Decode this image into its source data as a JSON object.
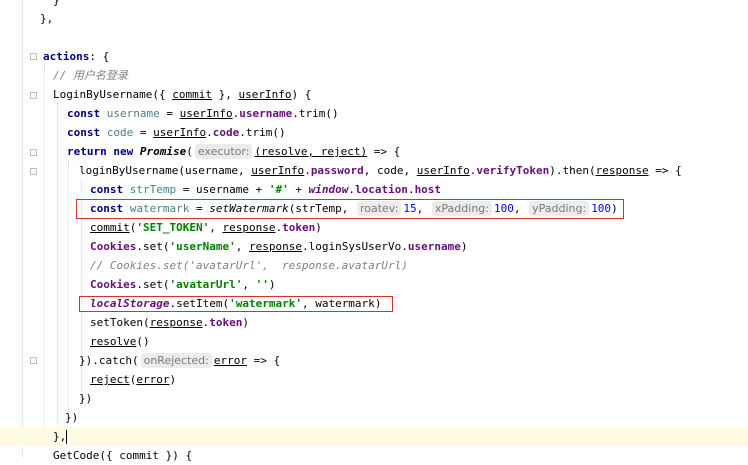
{
  "code": {
    "l0": {
      "text": "}"
    },
    "l1": {
      "text": "},"
    },
    "l3": {
      "kw": "actions",
      "rest": ": {"
    },
    "l4": {
      "comment": "// 用户名登录"
    },
    "l5": {
      "name": "LoginByUsername",
      "p1": "({ ",
      "commit": "commit",
      "p2": " }, ",
      "userInfo": "userInfo",
      "p3": ") {"
    },
    "l6": {
      "kw": "const",
      "var": " username",
      "eq": " = ",
      "obj": "userInfo",
      "dot": ".",
      "prop": "username",
      "dot2": ".",
      "call": "trim()"
    },
    "l7": {
      "kw": "const",
      "var": " code",
      "eq": " = ",
      "obj": "userInfo",
      "dot": ".",
      "prop": "code",
      "dot2": ".",
      "call": "trim()"
    },
    "l8": {
      "kw1": "return",
      "kw2": "new",
      "cls": "Promise",
      "open": "(",
      "hint": "executor:",
      "args": "(resolve, reject)",
      "arrow": " => {"
    },
    "l9": {
      "fn": "loginByUsername",
      "a1": "(username, ",
      "obj": "userInfo",
      "dot": ".",
      "prop1": "password",
      "a2": ", code, ",
      "obj2": "userInfo",
      "dot2": ".",
      "prop2": "verifyToken",
      "a3": ").then(",
      "resp": "response",
      "a4": " => {"
    },
    "l10": {
      "kw": "const",
      "var": " strTemp",
      "eq": " = username + ",
      "str": "'#'",
      "plus": " + ",
      "glob": "window",
      "dot": ".",
      "prop": "location",
      "dot2": ".",
      "prop2": "host"
    },
    "l11": {
      "kw": "const",
      "var": " watermark",
      "eq": " = ",
      "fn": "setWatermark",
      "a1": "(strTemp,",
      "h1": "roatev:",
      "n1": "15",
      "c1": ",",
      "h2": "xPadding:",
      "n2": "100",
      "c2": ",",
      "h3": "yPadding:",
      "n3": "100",
      "close": ")"
    },
    "l12": {
      "fn": "commit",
      "open": "(",
      "str": "'SET_TOKEN'",
      "mid": ", ",
      "obj": "response",
      "dot": ".",
      "prop": "token",
      "close": ")"
    },
    "l13": {
      "obj": "Cookies",
      "dot": ".",
      "meth": "set",
      "open": "(",
      "str": "'userName'",
      "mid": ", ",
      "obj2": "response",
      "dot2": ".",
      "meth2": "loginSysUserVo",
      "dot3": ".",
      "prop": "username",
      "close": ")"
    },
    "l14": {
      "comment": "// Cookies.set('avatarUrl',  response.avatarUrl)"
    },
    "l15": {
      "obj": "Cookies",
      "dot": ".",
      "meth": "set",
      "open": "(",
      "str": "'avatarUrl'",
      "mid": ", ",
      "str2": "''",
      "close": ")"
    },
    "l16": {
      "glob": "localStorage",
      "dot": ".",
      "meth": "setItem",
      "open": "(",
      "str": "'watermark'",
      "mid": ", watermark",
      "close": ")"
    },
    "l17": {
      "fn": "setToken",
      "open": "(",
      "obj": "response",
      "dot": ".",
      "prop": "token",
      "close": ")"
    },
    "l18": {
      "fn": "resolve",
      "call": "()"
    },
    "l19": {
      "close": "}).catch(",
      "hint": "onRejected:",
      "arg": "error",
      "arrow": " => {"
    },
    "l20": {
      "fn": "reject",
      "open": "(",
      "arg": "error",
      "close": ")"
    },
    "l21": {
      "text": "})"
    },
    "l22": {
      "text": "})"
    },
    "l23": {
      "text": "},"
    },
    "l24": {
      "name": "GetCode",
      "rest": "({ commit }) {"
    }
  },
  "colors": {
    "keyword": "#000080",
    "property": "#660e7a",
    "string": "#008000",
    "number": "#0000ff",
    "comment": "#808080",
    "highlight_box": "#d8312c",
    "current_line": "#fffae3"
  }
}
